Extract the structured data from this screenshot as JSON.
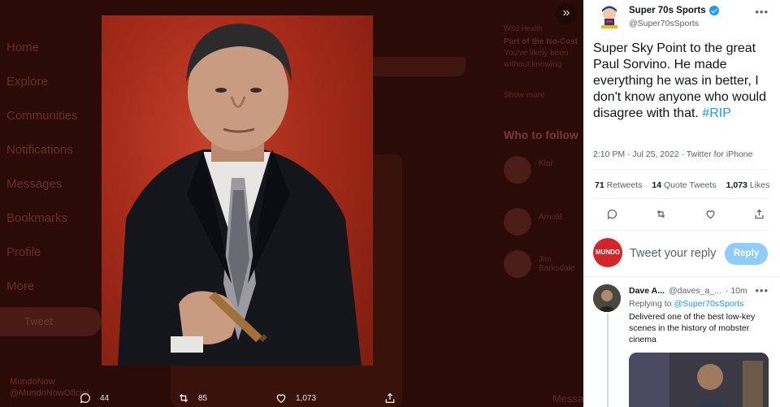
{
  "background": {
    "nav": [
      "Home",
      "Explore",
      "Communities",
      "Notifications",
      "Messages",
      "Bookmarks",
      "Profile",
      "More"
    ],
    "tweet_button": "Tweet",
    "account_name": "MundoNow",
    "account_handle": "@MundoNowOficial",
    "right_col": {
      "trend_source": "WSJ Health",
      "trend_line1": "Part of the No-Cost",
      "trend_line2": "You've likely been",
      "trend_line3": "without knowing",
      "show_more": "Show more",
      "who_to_follow": "Who to follow",
      "suggestions": [
        "Klar",
        "Arnold",
        "Jim Barksdale"
      ]
    },
    "messages_label": "Messages"
  },
  "media_actions": {
    "replies": "44",
    "retweets": "85",
    "likes": "1,073"
  },
  "tweet": {
    "name": "Super 70s Sports",
    "handle": "@Super70sSports",
    "text_main": "Super Sky Point to the great Paul Sorvino. He made everything he was in better, I don't know anyone who would disagree with that. ",
    "hashtag": "#RIP",
    "timestamp": "2:10 PM · Jul 25, 2022 · Twitter for iPhone",
    "retweets_count": "71",
    "retweets_label": "Retweets",
    "quotes_count": "14",
    "quotes_label": "Quote Tweets",
    "likes_count": "1,073",
    "likes_label": "Likes"
  },
  "reply_box": {
    "avatar_text": "MUNDO",
    "placeholder": "Tweet your reply",
    "button": "Reply"
  },
  "comment": {
    "name": "Dave A...",
    "handle": "@daves_a_...",
    "time": "· 10m",
    "replying_prefix": "Replying to ",
    "replying_to": "@Super70sSports",
    "text": "Delivered one of the best low-key scenes in the history of mobster cinema"
  },
  "colors": {
    "accent": "#1d9bf0",
    "reply_button": "#8ecdf8",
    "photo_bg": "#a52a19"
  }
}
